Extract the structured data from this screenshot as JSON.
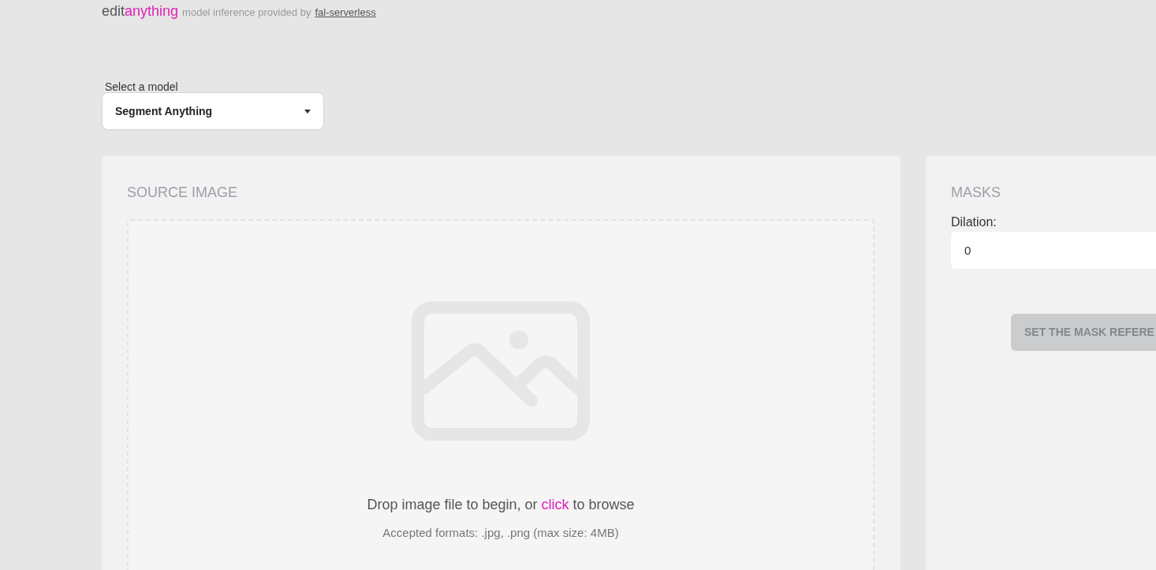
{
  "header": {
    "brand_plain": "edit",
    "brand_accent": "anything",
    "tagline": "model inference provided by",
    "link": "fal-serverless"
  },
  "model_select": {
    "label": "Select a model",
    "value": "Segment Anything"
  },
  "source_panel": {
    "title": "SOURCE IMAGE",
    "drop_before": "Drop image file to begin, or",
    "drop_link": "click",
    "drop_after": "to browse",
    "formats": "Accepted formats: .jpg, .png (max size: 4MB)"
  },
  "masks_panel": {
    "title": "MASKS",
    "dilation_label": "Dilation:",
    "dilation_value": "0",
    "button": {
      "label": "SET THE MASK REFERE",
      "disabled": true
    }
  }
}
